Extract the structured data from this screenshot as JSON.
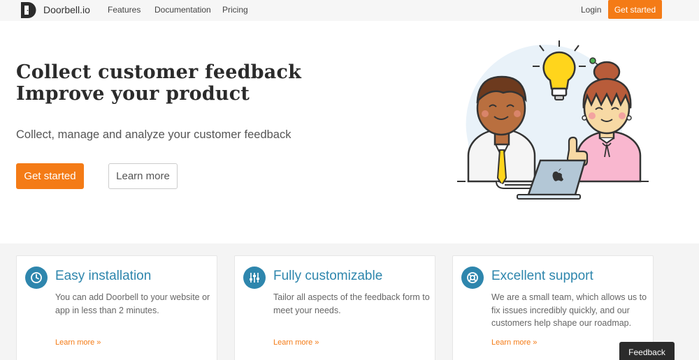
{
  "nav": {
    "brand": "Doorbell.io",
    "links": [
      "Features",
      "Documentation",
      "Pricing"
    ],
    "login": "Login",
    "cta": "Get started"
  },
  "hero": {
    "title_line1": "Collect customer feedback",
    "title_line2": "Improve your product",
    "subtitle": "Collect, manage and analyze your customer feedback",
    "primary_button": "Get started",
    "secondary_button": "Learn more"
  },
  "features": [
    {
      "icon": "clock-icon",
      "title": "Easy installation",
      "text": "You can add Doorbell to your website or app in less than 2 minutes.",
      "link": "Learn more »"
    },
    {
      "icon": "sliders-icon",
      "title": "Fully customizable",
      "text": "Tailor all aspects of the feedback form to meet your needs.",
      "link": "Learn more »"
    },
    {
      "icon": "lifebuoy-icon",
      "title": "Excellent support",
      "text": "We are a small team, which allows us to fix issues incredibly quickly, and our customers help shape our roadmap.",
      "link": "Learn more »"
    }
  ],
  "feedback_tab": "Feedback",
  "colors": {
    "accent_orange": "#f47b16",
    "accent_blue": "#2e86ad",
    "nav_bg": "#f6f6f6",
    "features_bg": "#f4f4f4"
  }
}
